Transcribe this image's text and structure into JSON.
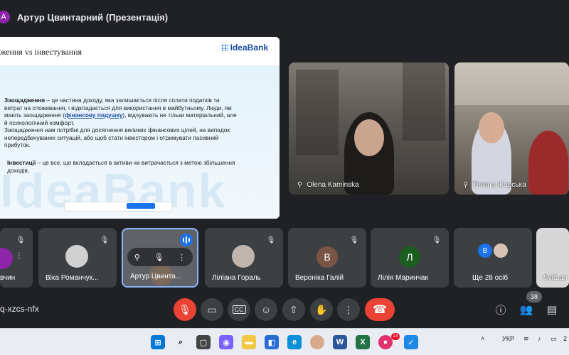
{
  "window": {
    "avatar_letter": "А",
    "title": "Артур Цвинтарний (Презентація)"
  },
  "slide": {
    "title": "ження vs інвестування",
    "brand": "IdeaBank",
    "watermark": "IdeaBank",
    "p1_term": "Заощадження",
    "p1_text_a": " – це частина доходу, яка залишається після сплати податків та витрат на споживання, і відкладається для використання в майбутньому. Люди, які мають заощадження (",
    "p1_link": "фінансову подушку",
    "p1_text_b": "), відчувають не тільки матеріальний, але й психологічний комфорт.",
    "p1_text_c": "Заощадження нам потрібні для досягнення великих фінансових цілей, на випадок непередбачуваних ситуацій, або щоб стати інвестором і отримувати пасивний прибуток.",
    "p2_term": "Інвестиції",
    "p2_text": " – це все, що вкладається в активи чи витрачається з метою збільшення доходів."
  },
  "tiles": {
    "olena": "Olena Kaminska",
    "tetiana": "Тетяна Жарська"
  },
  "strip": [
    {
      "name": "вчин",
      "initial": "",
      "color": "#8e24aa"
    },
    {
      "name": "Віка Романчук...",
      "initial": "",
      "color": "#d0d0d0"
    },
    {
      "name": "Артур Цвинта...",
      "initial": "",
      "color": "#5f6368"
    },
    {
      "name": "Ліліана Гораль",
      "initial": "",
      "color": "#c0b6ad"
    },
    {
      "name": "Вероніка Галій",
      "initial": "В",
      "color": "#795548"
    },
    {
      "name": "Лілія Маринчак",
      "initial": "Л",
      "color": "#1b5e20"
    },
    {
      "name": "Ще 28 осіб",
      "initial": "В",
      "color": "#1a73e8"
    },
    {
      "name": "SvitLan",
      "initial": "",
      "color": "#d7d7d7"
    }
  ],
  "controls": {
    "meet_code": "q-xzcs-nfx",
    "participants_count": "38"
  },
  "taskbar": {
    "notif_count": "23",
    "lang": "УКР",
    "time_fragment": "2"
  },
  "colors": {
    "accent": "#8ab4f8",
    "danger": "#ea4335",
    "surface": "#3c4043",
    "bg": "#202124"
  }
}
